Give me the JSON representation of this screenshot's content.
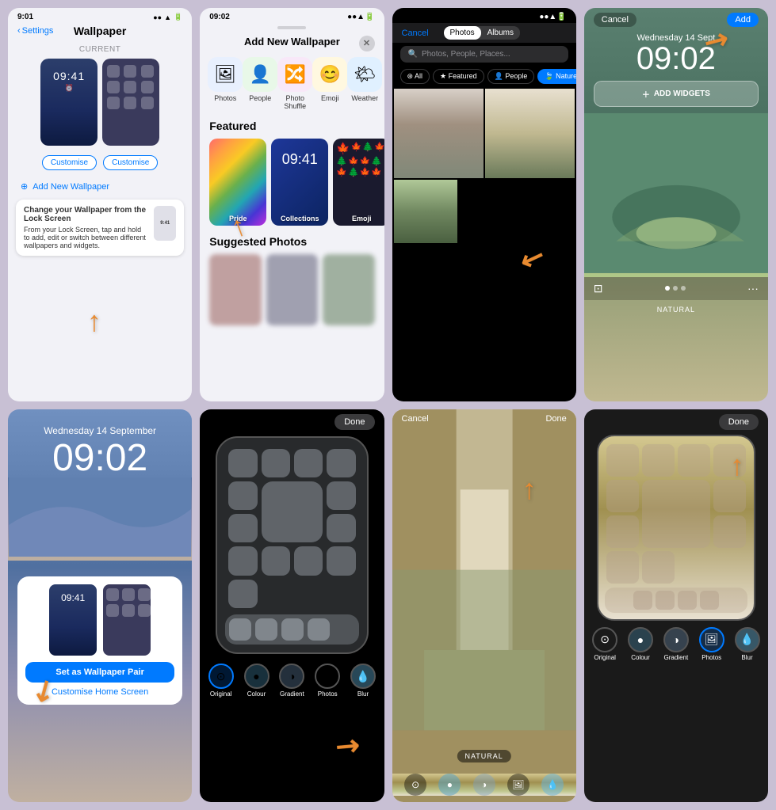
{
  "cells": {
    "cell1": {
      "status_time": "9:01",
      "status_icons": "●●▲",
      "back_label": "Settings",
      "title": "Wallpaper",
      "current_label": "CURRENT",
      "lock_time": "09:41",
      "customize_lock": "Customise",
      "customize_home": "Customise",
      "add_new": "Add New Wallpaper",
      "tooltip_title": "Change your Wallpaper from the Lock Screen",
      "tooltip_body": "From your Lock Screen, tap and hold to add, edit or switch between different wallpapers and widgets."
    },
    "cell2": {
      "status_time": "09:02",
      "title": "Add New Wallpaper",
      "icons": [
        {
          "label": "Photos",
          "emoji": "🖼"
        },
        {
          "label": "People",
          "emoji": "👤"
        },
        {
          "label": "Photo Shuffle",
          "emoji": "🔀"
        },
        {
          "label": "Emoji",
          "emoji": "😊"
        },
        {
          "label": "Weather",
          "emoji": "🌤"
        }
      ],
      "featured_label": "Featured",
      "cards": [
        {
          "label": "Pride"
        },
        {
          "label": "Collections"
        },
        {
          "label": "Emoji"
        }
      ],
      "suggested_label": "Suggested Photos"
    },
    "cell3": {
      "cancel_label": "Cancel",
      "tab_photos": "Photos",
      "tab_albums": "Albums",
      "search_placeholder": "Photos, People, Places...",
      "filters": [
        "All",
        "Featured",
        "People",
        "Nature"
      ],
      "active_filter": "Nature"
    },
    "cell4": {
      "cancel_label": "Cancel",
      "add_label": "Add",
      "date": "Wednesday 14 Sept",
      "time": "09:02",
      "add_widgets": "ADD WIDGETS",
      "natural_label": "NATURAL"
    },
    "cell5": {
      "date": "Wednesday 14 September",
      "time": "09:02",
      "set_pair_label": "Set as Wallpaper Pair",
      "customise_home": "Customise Home Screen"
    },
    "cell6": {
      "done_label": "Done",
      "tools": [
        {
          "label": "Original",
          "emoji": "⊙"
        },
        {
          "label": "Colour",
          "emoji": "●"
        },
        {
          "label": "Gradient",
          "emoji": "◑"
        },
        {
          "label": "Photos",
          "emoji": "🖼"
        },
        {
          "label": "Blur",
          "emoji": "💧"
        }
      ]
    },
    "cell7": {
      "cancel_label": "Cancel",
      "done_label": "Done",
      "natural_label": "NATURAL",
      "tools": [
        {
          "label": "⊙"
        },
        {
          "label": "●"
        },
        {
          "label": "◑"
        },
        {
          "label": "🖼"
        },
        {
          "label": "💧"
        }
      ]
    },
    "cell8": {
      "done_label": "Done",
      "tools": [
        {
          "label": "Original",
          "emoji": "⊙"
        },
        {
          "label": "Colour",
          "emoji": "●"
        },
        {
          "label": "Gradient",
          "emoji": "◑"
        },
        {
          "label": "Photos",
          "emoji": "🖼"
        },
        {
          "label": "Blur",
          "emoji": "💧"
        }
      ]
    }
  }
}
